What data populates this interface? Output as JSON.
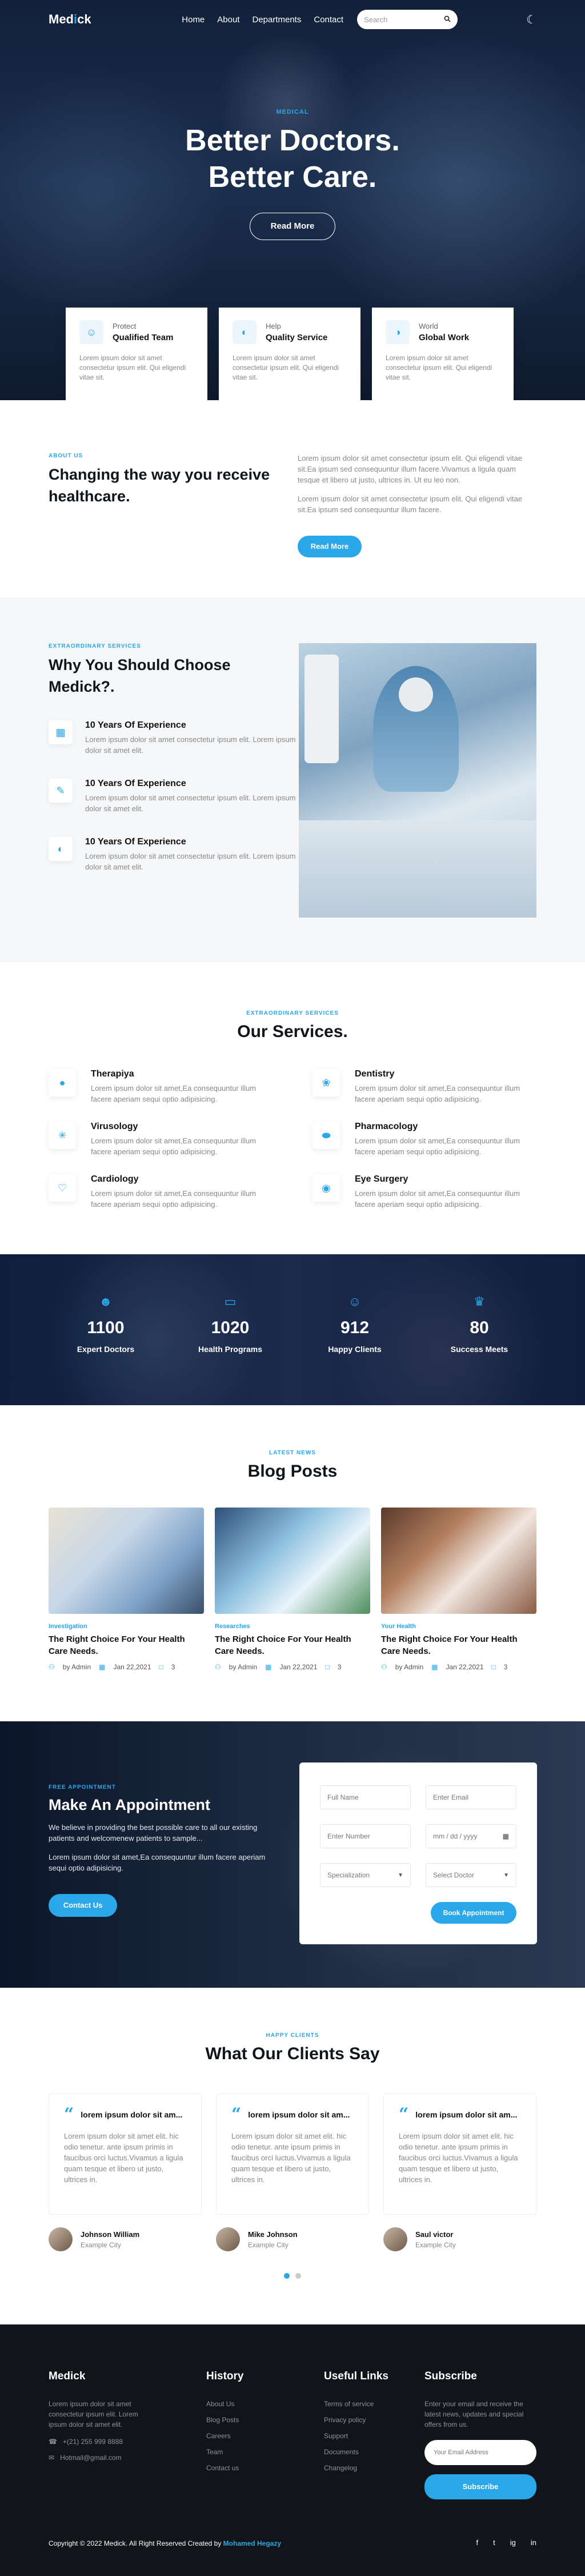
{
  "nav": {
    "logo_pre": "Med",
    "logo_accent": "i",
    "logo_post": "ck",
    "links": [
      "Home",
      "About",
      "Departments",
      "Contact"
    ],
    "search_placeholder": "Search"
  },
  "hero": {
    "tag": "MEDICAL",
    "title_line1": "Better Doctors.",
    "title_line2": "Better Care.",
    "button": "Read More"
  },
  "cards": [
    {
      "small": "Protect",
      "big": "Qualified Team",
      "text": "Lorem ipsum dolor sit amet consectetur ipsum elit. Qui eligendi vitae sit.",
      "icon": "team-icon"
    },
    {
      "small": "Help",
      "big": "Quality Service",
      "text": "Lorem ipsum dolor sit amet consectetur ipsum elit. Qui eligendi vitae sit.",
      "icon": "shield-icon"
    },
    {
      "small": "World",
      "big": "Global Work",
      "text": "Lorem ipsum dolor sit amet consectetur ipsum elit. Qui eligendi vitae sit.",
      "icon": "globe-icon"
    }
  ],
  "about": {
    "tag": "ABOUT US",
    "title": "Changing the way you receive healthcare.",
    "p1": "Lorem ipsum dolor sit amet consectetur ipsum elit. Qui eligendi vitae sit.Ea ipsum sed consequuntur illum facere.Vivamus a ligula quam tesque et libero ut justo, ultrices in. Ut eu leo non.",
    "p2": "Lorem ipsum dolor sit amet consectetur ipsum elit. Qui eligendi vitae sit.Ea ipsum sed consequuntur illum facere.",
    "button": "Read More"
  },
  "why": {
    "tag": "EXTRAORDINARY SERVICES",
    "title": "Why You Should Choose Medick?.",
    "features": [
      {
        "title": "10 Years Of Experience",
        "text": "Lorem ipsum dolor sit amet consectetur ipsum elit. Lorem ipsum dolor sit amet elit.",
        "icon": "calendar-icon"
      },
      {
        "title": "10 Years Of Experience",
        "text": "Lorem ipsum dolor sit amet consectetur ipsum elit. Lorem ipsum dolor sit amet elit.",
        "icon": "edit-icon"
      },
      {
        "title": "10 Years Of Experience",
        "text": "Lorem ipsum dolor sit amet consectetur ipsum elit. Lorem ipsum dolor sit amet elit.",
        "icon": "shield-icon"
      }
    ]
  },
  "services": {
    "tag": "EXTRAORDINARY SERVICES",
    "title": "Our Services.",
    "items": [
      {
        "title": "Therapiya",
        "text": "Lorem ipsum dolor sit amet,Ea consequuntur illum facere aperiam sequi optio adipisicing.",
        "icon": "pills-icon",
        "glyph": "●"
      },
      {
        "title": "Dentistry",
        "text": "Lorem ipsum dolor sit amet,Ea consequuntur illum facere aperiam sequi optio adipisicing.",
        "icon": "tooth-icon",
        "glyph": "❀"
      },
      {
        "title": "Virusology",
        "text": "Lorem ipsum dolor sit amet,Ea consequuntur illum facere aperiam sequi optio adipisicing.",
        "icon": "virus-icon",
        "glyph": "✳"
      },
      {
        "title": "Pharmacology",
        "text": "Lorem ipsum dolor sit amet,Ea consequuntur illum facere aperiam sequi optio adipisicing.",
        "icon": "capsule-icon",
        "glyph": "⬬"
      },
      {
        "title": "Cardiology",
        "text": "Lorem ipsum dolor sit amet,Ea consequuntur illum facere aperiam sequi optio adipisicing.",
        "icon": "heartbeat-icon",
        "glyph": "♡"
      },
      {
        "title": "Eye Surgery",
        "text": "Lorem ipsum dolor sit amet,Ea consequuntur illum facere aperiam sequi optio adipisicing.",
        "icon": "eye-icon",
        "glyph": "◉"
      }
    ]
  },
  "counters": [
    {
      "num": "1100",
      "label": "Expert Doctors",
      "icon": "users-icon",
      "glyph": "☻"
    },
    {
      "num": "1020",
      "label": "Health Programs",
      "icon": "laptop-icon",
      "glyph": "▭"
    },
    {
      "num": "912",
      "label": "Happy Clients",
      "icon": "smile-icon",
      "glyph": "☺"
    },
    {
      "num": "80",
      "label": "Success Meets",
      "icon": "trophy-icon",
      "glyph": "♛"
    }
  ],
  "blog": {
    "tag": "LATEST NEWS",
    "title": "Blog Posts",
    "posts": [
      {
        "tag": "Investigation",
        "title": "The Right Choice For Your Health Care Needs.",
        "author": "by Admin",
        "date": "Jan 22,2021",
        "comments": "3"
      },
      {
        "tag": "Researches",
        "title": "The Right Choice For Your Health Care Needs.",
        "author": "by Admin",
        "date": "Jan 22,2021",
        "comments": "3"
      },
      {
        "tag": "Your Health",
        "title": "The Right Choice For Your Health Care Needs.",
        "author": "by Admin",
        "date": "Jan 22,2021",
        "comments": "3"
      }
    ]
  },
  "appointment": {
    "tag": "FREE APPOINTMENT",
    "title": "Make An Appointment",
    "p1": "We believe in providing the best possible care to all our existing patients and welcomenew patients to sample...",
    "p2": "Lorem ipsum dolor sit amet,Ea consequuntur illum facere aperiam sequi optio adipisicing.",
    "button": "Contact Us",
    "form": {
      "full_name": "Full Name",
      "email": "Enter Email",
      "number": "Enter Number",
      "date": "mm / dd / yyyy",
      "specialization": "Specialization",
      "doctor": "Select Doctor",
      "submit": "Book Appointment"
    }
  },
  "testimonials": {
    "tag": "HAPPY CLIENTS",
    "title": "What Our Clients Say",
    "items": [
      {
        "head": "lorem ipsum dolor sit am...",
        "text": "Lorem ipsum dolor sit amet elit. hic odio tenetur. ante ipsum primis in faucibus orci luctus.Vivamus a ligula quam tesque et libero ut justo, ultrices in.",
        "name": "Johnson William",
        "city": "Example City"
      },
      {
        "head": "lorem ipsum dolor sit am...",
        "text": "Lorem ipsum dolor sit amet elit. hic odio tenetur. ante ipsum primis in faucibus orci luctus.Vivamus a ligula quam tesque et libero ut justo, ultrices in.",
        "name": "Mike Johnson",
        "city": "Example City"
      },
      {
        "head": "lorem ipsum dolor sit am...",
        "text": "Lorem ipsum dolor sit amet elit. hic odio tenetur. ante ipsum primis in faucibus orci luctus.Vivamus a ligula quam tesque et libero ut justo, ultrices in.",
        "name": "Saul victor",
        "city": "Example City"
      }
    ]
  },
  "footer": {
    "brand": "Medick",
    "about": "Lorem ipsum dolor sit amet consectetur ipsum elit. Lorem ipsum dolor sit amet elit.",
    "phone": "+(21) 255 999 8888",
    "email": "Hotmail@gmail.com",
    "history_title": "History",
    "history": [
      "About Us",
      "Blog Posts",
      "Careers",
      "Team",
      "Contact us"
    ],
    "links_title": "Useful Links",
    "links": [
      "Terms of service",
      "Privacy policy",
      "Support",
      "Documents",
      "Changelog"
    ],
    "subscribe_title": "Subscribe",
    "subscribe_text": "Enter your email and receive the latest news, updates and special offers from us.",
    "email_placeholder": "Your Email Address",
    "subscribe_button": "Subscribe",
    "copyright": "Copyright © 2022 Medick. All Right Reserved Created by",
    "author": "Mohamed Hegazy",
    "social": [
      "f",
      "t",
      "ig",
      "in"
    ]
  },
  "colors": {
    "accent": "#2aa7e8",
    "dark": "#111418"
  }
}
